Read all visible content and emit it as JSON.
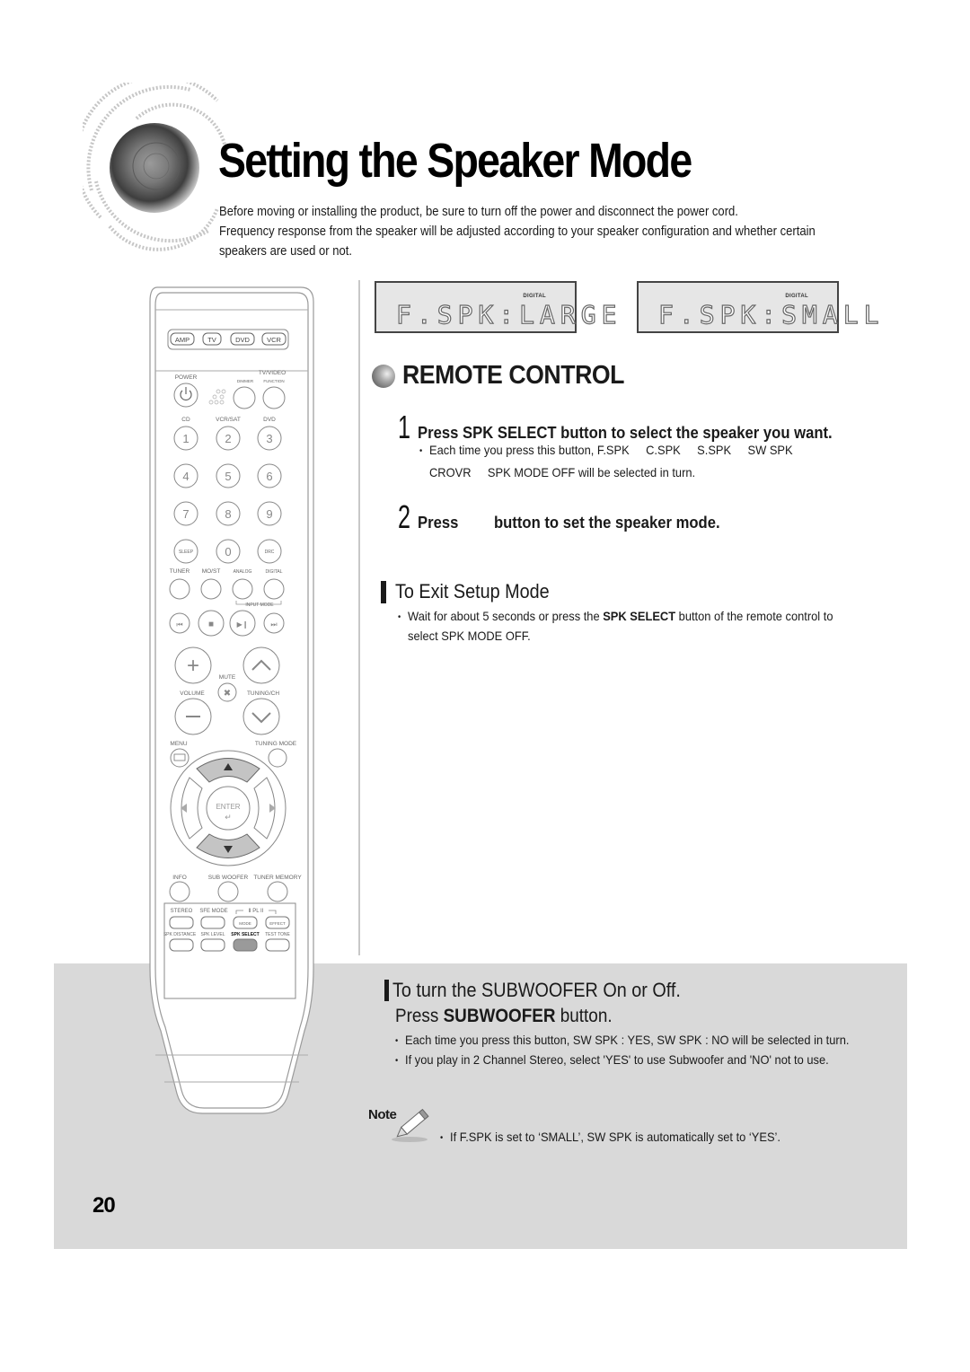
{
  "header": {
    "title": "Setting the Speaker Mode",
    "intro": [
      "Before moving or installing the product, be sure to turn off the power and disconnect the power cord.",
      "Frequency response from the speaker will be adjusted according to your speaker configuration and whether certain",
      "speakers are used or not."
    ],
    "logo_icon": "speaker-cone-icon"
  },
  "displays": [
    {
      "indicator": "DIGITAL",
      "readout": "F.SPK:LARGE"
    },
    {
      "indicator": "DIGITAL",
      "readout": "F.SPK:SMALL"
    }
  ],
  "remote_control_section": {
    "title": "REMOTE CONTROL",
    "steps": [
      {
        "number": "1",
        "text": "Press SPK SELECT button to select the speaker you want.",
        "detail_prefix": "Each time you press this button,",
        "cycle": [
          "F.SPK",
          "C.SPK",
          "S.SPK",
          "SW SPK",
          "CROVR",
          "SPK MODE OFF"
        ],
        "detail_suffix": "will be selected in turn."
      },
      {
        "number": "2",
        "text_before": "Press",
        "text_after": "button to set the speaker mode."
      }
    ]
  },
  "exit_setup": {
    "title": "To Exit Setup Mode",
    "text_before": "Wait for about 5 seconds or press the",
    "text_bold": "SPK SELECT",
    "text_after": "button of the remote control to",
    "text_line2": "select SPK MODE OFF."
  },
  "subwoofer": {
    "title": "To turn the SUBWOOFER On or Off.",
    "press_before": "Press",
    "press_bold": "SUBWOOFER",
    "press_after": "button.",
    "bullets": [
      "Each time you press this button, SW SPK : YES, SW SPK : NO will be selected in turn.",
      "If you play in 2 Channel Stereo, select 'YES' to use Subwoofer and 'NO' not to use."
    ]
  },
  "note": {
    "label": "Note",
    "text": "If F.SPK is set to  ‘SMALL’, SW SPK is automatically set to ‘YES’."
  },
  "page_number": "20",
  "remote": {
    "modes": [
      "AMP",
      "TV",
      "DVD",
      "VCR"
    ],
    "power": "POWER",
    "tv_video": "TV/VIDEO",
    "dimmer": "DIMMER",
    "function": "FUNCTION",
    "source_labels": [
      "CD",
      "VCR/SAT",
      "DVD"
    ],
    "digits": [
      "1",
      "2",
      "3",
      "4",
      "5",
      "6",
      "7",
      "8",
      "9"
    ],
    "sleep": "SLEEP",
    "zero": "0",
    "drc": "DRC",
    "row_labels": [
      "TUNER",
      "MO/ST",
      "ANALOG",
      "DIGITAL"
    ],
    "input_mode": "INPUT MODE",
    "mute": "MUTE",
    "volume": "VOLUME",
    "tuning_ch": "TUNING/CH",
    "menu": "MENU",
    "tuning_mode": "TUNING MODE",
    "enter": "ENTER",
    "bottom_labels": [
      "INFO",
      "SUB WOOFER",
      "TUNER MEMORY"
    ],
    "panel_row1": [
      "STEREO",
      "SFE MODE",
      "MODE",
      "EFFECT"
    ],
    "pl2": "PL II",
    "panel_row2": [
      "SPK DISTANCE",
      "SPK LEVEL",
      "SPK SELECT",
      "TEST TONE"
    ],
    "highlight_color": "#9a9a9a"
  },
  "colors": {
    "band": "#d9d9d9",
    "text": "#1a1a1a"
  }
}
